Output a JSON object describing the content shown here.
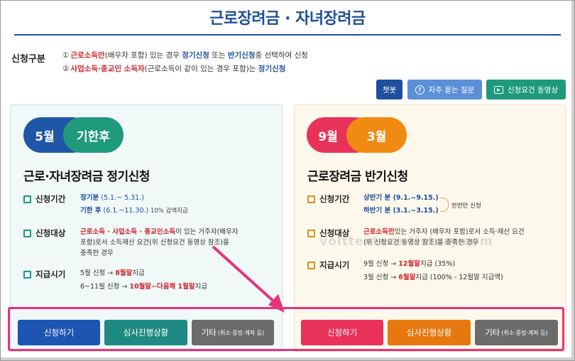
{
  "page": {
    "title": "근로장려금 · 자녀장려금"
  },
  "requirement": {
    "label": "신청구분",
    "line1": {
      "num": "①",
      "part1": "근로소득만",
      "part2": "(배우자 포함) 있는 경우 ",
      "part3": "정기신청",
      "part4": " 또는 ",
      "part5": "반기신청",
      "part6": "중 선택하여 신청"
    },
    "line2": {
      "num": "②",
      "part1": "사업소득·종교인 소득자",
      "part2": "(근로소득이 같이 있는 경우 포함)는 ",
      "part3": "정기신청"
    }
  },
  "top_buttons": {
    "chatbot": "챗봇",
    "faq": "자주 묻는 질문",
    "video": "신청요건 동영상"
  },
  "left_panel": {
    "pill1": "5월",
    "pill2": "기한후",
    "title": "근로·자녀장려금 정기신청",
    "period_label": "신청기간",
    "period1_a": "정기분",
    "period1_b": " (5.1.~ 5.31.)",
    "period2_a": "기한 후",
    "period2_b": " (6.1.~11.30.)",
    "period2_c": " 10% 감액지급",
    "target_label": "신청대상",
    "target1_a": "근로소득 · 사업소득 · 종교인소득",
    "target1_b": "이 있는 거주자(배우자",
    "target2": "포함)로서 소득재산 요건(위 신청요건 동영상 참조)을",
    "target3": "충족한 경우",
    "pay_label": "지급시기",
    "pay1_a": "5월 신청 → ",
    "pay1_b": "8월말",
    "pay1_c": "지급",
    "pay2_a": "6~11월 신청 → ",
    "pay2_b": "10월말~다음해 1월말",
    "pay2_c": "지급"
  },
  "right_panel": {
    "pill1": "9월",
    "pill2": "3월",
    "title": "근로장려금 반기신청",
    "period_label": "신청기간",
    "period1_a": "상반기 분",
    "period1_b": " (9.1.~9.15.)",
    "period2_a": "하반기 분",
    "period2_b": " (3.1.~3.15.)",
    "period_note": "한번만 신청",
    "target_label": "신청대상",
    "target1_a": "근로소득만",
    "target1_b": "있는 거주자 (배우자 포함)로서 소득·재산 요건",
    "target2": "(위 신청요건 동영상 참조)을 충족한 경우",
    "pay_label": "지급시기",
    "pay1_a": "9월 신청 → ",
    "pay1_b": "12월말",
    "pay1_c": "지급 (35%)",
    "pay2_a": "3월 신청 → ",
    "pay2_b": "6월말",
    "pay2_c": "지급 (100% - 12월말 지급액)"
  },
  "bottom_buttons": {
    "left_apply": "신청하기",
    "left_status": "심사진행상황",
    "left_etc": "기타",
    "left_etc_sub": "(취소·증빙·계좌 등)",
    "right_apply": "신청하기",
    "right_status": "심사진행상황",
    "right_etc": "기타",
    "right_etc_sub": "(취소·증빙·계좌 등)"
  },
  "watermark": "volttexture.tistory.com",
  "colors": {
    "title_blue": "#1d4f9c",
    "accent_red": "#d0262f",
    "highlight_pink": "#e8327b",
    "left_apply": "#1e55b3",
    "left_status": "#1e8a82",
    "etc_gray": "#6b6b6b",
    "right_apply": "#e8325a",
    "right_status": "#e6780f"
  }
}
